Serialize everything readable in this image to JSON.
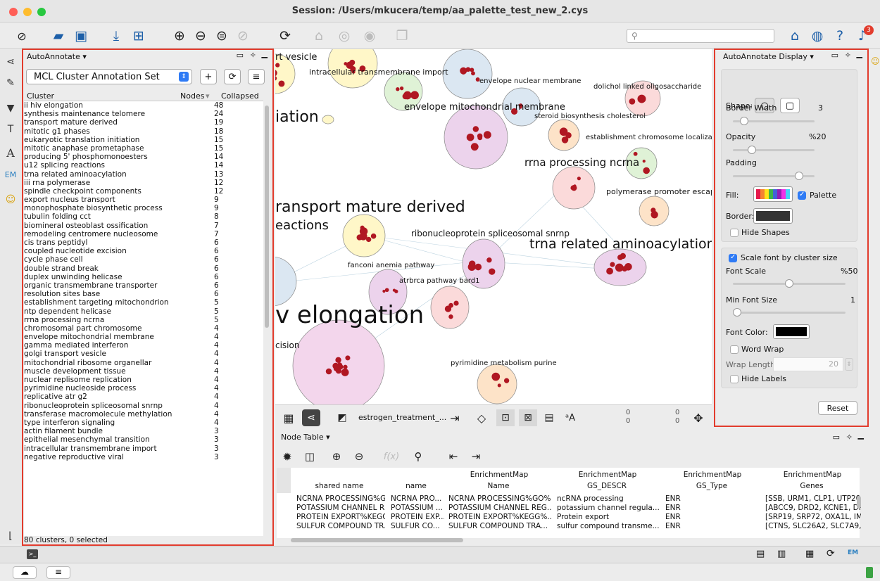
{
  "window": {
    "title": "Session: /Users/mkucera/temp/aa_palette_test_new_2.cys"
  },
  "toolbar": {
    "search_placeholder": "",
    "notification_count": "3"
  },
  "autoannotate_panel": {
    "title": "AutoAnnotate ▾",
    "annotation_set": "MCL Cluster Annotation Set",
    "columns": [
      "Cluster",
      "Nodes",
      "Collapsed"
    ],
    "rows": [
      [
        "ii hiv elongation",
        "48"
      ],
      [
        "synthesis maintenance telomere",
        "24"
      ],
      [
        "transport mature derived",
        "19"
      ],
      [
        "mitotic g1 phases",
        "18"
      ],
      [
        "eukaryotic translation initiation",
        "15"
      ],
      [
        "mitotic anaphase prometaphase",
        "15"
      ],
      [
        "producing 5' phosphomonoesters",
        "14"
      ],
      [
        "u12 splicing reactions",
        "14"
      ],
      [
        "trna related aminoacylation",
        "13"
      ],
      [
        "iii rna polymerase",
        "12"
      ],
      [
        "spindle checkpoint components",
        "12"
      ],
      [
        "export nucleus transport",
        "9"
      ],
      [
        "monophosphate biosynthetic process",
        "9"
      ],
      [
        "tubulin folding cct",
        "8"
      ],
      [
        "biomineral osteoblast ossification",
        "7"
      ],
      [
        "remodeling centromere nucleosome",
        "7"
      ],
      [
        "cis trans peptidyl",
        "6"
      ],
      [
        "coupled nucleotide excision",
        "6"
      ],
      [
        "cycle phase cell",
        "6"
      ],
      [
        "double strand break",
        "6"
      ],
      [
        "duplex unwinding helicase",
        "6"
      ],
      [
        "organic transmembrane transporter",
        "6"
      ],
      [
        "resolution sites base",
        "6"
      ],
      [
        "establishment targeting mitochondrion",
        "5"
      ],
      [
        "ntp dependent helicase",
        "5"
      ],
      [
        "rrna processing ncrna",
        "5"
      ],
      [
        "chromosomal part chromosome",
        "4"
      ],
      [
        "envelope mitochondrial membrane",
        "4"
      ],
      [
        "gamma mediated interferon",
        "4"
      ],
      [
        "golgi transport vesicle",
        "4"
      ],
      [
        "mitochondrial ribosome organellar",
        "4"
      ],
      [
        "muscle development tissue",
        "4"
      ],
      [
        "nuclear replisome replication",
        "4"
      ],
      [
        "pyrimidine nucleoside process",
        "4"
      ],
      [
        "replicative atr g2",
        "4"
      ],
      [
        "ribonucleoprotein spliceosomal snrnp",
        "4"
      ],
      [
        "transferase macromolecule methylation",
        "4"
      ],
      [
        "type interferon signaling",
        "4"
      ],
      [
        "actin filament bundle",
        "3"
      ],
      [
        "epithelial mesenchymal transition",
        "3"
      ],
      [
        "intracellular transmembrane import",
        "3"
      ],
      [
        "negative reproductive viral",
        "3"
      ]
    ],
    "footer": "80 clusters, 0 selected"
  },
  "network": {
    "labels": [
      {
        "t": "rt vesicle",
        "size": "13px"
      },
      {
        "t": "intracellular transmembrane import",
        "size": "11px"
      },
      {
        "t": "envelope nuclear membrane",
        "size": "10px"
      },
      {
        "t": "dolichol linked oligosaccharide",
        "size": "10px"
      },
      {
        "t": "envelope mitochondrial membrane",
        "size": "13px"
      },
      {
        "t": "iation",
        "size": "22px"
      },
      {
        "t": "steroid biosynthesis cholesterol",
        "size": "10px"
      },
      {
        "t": "establishment chromosome localization",
        "size": "10px"
      },
      {
        "t": "rrna processing ncrna",
        "size": "15px"
      },
      {
        "t": "polymerase promoter escape",
        "size": "11px"
      },
      {
        "t": "ransport mature derived",
        "size": "22px"
      },
      {
        "t": "eactions",
        "size": "18px"
      },
      {
        "t": "ribonucleoprotein spliceosomal snrnp",
        "size": "12px"
      },
      {
        "t": "trna related aminoacylation",
        "size": "19px"
      },
      {
        "t": "fanconi anemia pathway",
        "size": "10px"
      },
      {
        "t": "atrbrca pathway bard1",
        "size": "10px"
      },
      {
        "t": "v elongation",
        "size": "34px"
      },
      {
        "t": "cision",
        "size": "12px"
      },
      {
        "t": "pyrimidine metabolism purine",
        "size": "10px"
      }
    ]
  },
  "network_toolbar": {
    "network_name": "estrogen_treatment_...",
    "sel_nodes": "0",
    "sel_edges": "0",
    "hidden_nodes": "0",
    "hidden_edges": "0"
  },
  "node_table": {
    "title": "Node Table ▾",
    "col_groups": [
      "EnrichmentMap",
      "EnrichmentMap",
      "EnrichmentMap",
      "EnrichmentMap"
    ],
    "columns": [
      "shared name",
      "name",
      "Name",
      "GS_DESCR",
      "GS_Type",
      "Genes"
    ],
    "rows": [
      [
        "NCRNA PROCESSING%G...",
        "NCRNA PRO...",
        "NCRNA PROCESSING%GO%...",
        "ncRNA processing",
        "ENR",
        "[SSB, URM1, CLP1, UTP20,"
      ],
      [
        "POTASSIUM CHANNEL R...",
        "POTASSIUM ...",
        "POTASSIUM CHANNEL REG...",
        "potassium channel regula...",
        "ENR",
        "[ABCC9, DRD2, KCNE1, DR"
      ],
      [
        "PROTEIN EXPORT%KEGG...",
        "PROTEIN EXP...",
        "PROTEIN EXPORT%KEGG%...",
        "Protein export",
        "ENR",
        "[SRP19, SRP72, OXA1L, IM."
      ],
      [
        "SULFUR COMPOUND TR...",
        "SULFUR CO...",
        "SULFUR COMPOUND TRA...",
        "sulfur compound transme...",
        "ENR",
        "[CTNS, SLC26A2, SLC7A9,"
      ]
    ]
  },
  "display_panel": {
    "title": "AutoAnnotate Display ▾",
    "shape_label": "Shape:",
    "border_width_label": "Border Width",
    "border_width_value": "3",
    "opacity_label": "Opacity",
    "opacity_value": "%20",
    "padding_label": "Padding",
    "fill_label": "Fill:",
    "palette_label": "Palette",
    "border_label": "Border:",
    "hide_shapes_label": "Hide Shapes",
    "scale_font_label": "Scale font by cluster size",
    "font_scale_label": "Font Scale",
    "font_scale_value": "%50",
    "min_font_label": "Min Font Size",
    "min_font_value": "1",
    "font_color_label": "Font Color:",
    "word_wrap_label": "Word Wrap",
    "wrap_length_label": "Wrap Length:",
    "wrap_length_value": "20",
    "hide_labels_label": "Hide Labels",
    "reset_label": "Reset",
    "colors": {
      "border": "#333333",
      "font": "#000000",
      "accent": "#2f7bf5",
      "highlight": "#e23c2d"
    },
    "levels": {
      "border_width": 0.1,
      "opacity": 0.2,
      "padding": 0.85,
      "font_scale": 0.5,
      "min_font_size": 0.0
    }
  }
}
